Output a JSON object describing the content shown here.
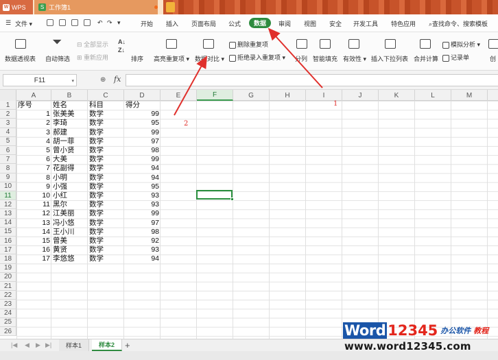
{
  "titlebar": {
    "app_label": "WPS",
    "document_tab": "工作簿1"
  },
  "menubar": {
    "file_label": "文件",
    "tabs": [
      {
        "label": "开始",
        "active": false
      },
      {
        "label": "插入",
        "active": false
      },
      {
        "label": "页面布局",
        "active": false
      },
      {
        "label": "公式",
        "active": false
      },
      {
        "label": "数据",
        "active": true
      },
      {
        "label": "审阅",
        "active": false
      },
      {
        "label": "视图",
        "active": false
      },
      {
        "label": "安全",
        "active": false
      },
      {
        "label": "开发工具",
        "active": false
      },
      {
        "label": "特色应用",
        "active": false
      }
    ],
    "search_label": "查找命令、搜索模板"
  },
  "ribbon": {
    "pivot": "数据透视表",
    "autofilter": "自动筛选",
    "show_all": "全部显示",
    "reapply": "重新应用",
    "sort": "排序",
    "highlight_duplicates": "高亮重复项",
    "data_compare": "数据对比",
    "delete_duplicates": "删除重复项",
    "reject_duplicates": "拒绝录入重复项",
    "split_columns": "分列",
    "smart_fill": "智能填充",
    "validity": "有效性",
    "insert_dropdown": "插入下拉列表",
    "consolidate": "合并计算",
    "simulation": "模拟分析",
    "record_form": "记录单",
    "create_group": "创"
  },
  "formulabar": {
    "cell_ref": "F11",
    "fx_label": "fx",
    "value": ""
  },
  "grid": {
    "columns": [
      "A",
      "B",
      "C",
      "D",
      "E",
      "F",
      "G",
      "H",
      "I",
      "J",
      "K",
      "L",
      "M"
    ],
    "selected_column": "F",
    "selected_row": 11,
    "row_count": 26,
    "headers": {
      "a": "序号",
      "b": "姓名",
      "c": "科目",
      "d": "得分"
    },
    "rows": [
      {
        "id": 1,
        "name": "张美美",
        "subject": "数学",
        "score": 99
      },
      {
        "id": 2,
        "name": "李琦",
        "subject": "数学",
        "score": 95
      },
      {
        "id": 3,
        "name": "郝建",
        "subject": "数学",
        "score": 99
      },
      {
        "id": 4,
        "name": "胡一菲",
        "subject": "数学",
        "score": 97
      },
      {
        "id": 5,
        "name": "曾小贤",
        "subject": "数学",
        "score": 98
      },
      {
        "id": 6,
        "name": "大美",
        "subject": "数学",
        "score": 99
      },
      {
        "id": 7,
        "name": "花副得",
        "subject": "数学",
        "score": 94
      },
      {
        "id": 8,
        "name": "小明",
        "subject": "数学",
        "score": 94
      },
      {
        "id": 9,
        "name": "小强",
        "subject": "数学",
        "score": 95
      },
      {
        "id": 10,
        "name": "小红",
        "subject": "数学",
        "score": 93
      },
      {
        "id": 11,
        "name": "黑尔",
        "subject": "数学",
        "score": 93
      },
      {
        "id": 12,
        "name": "江美丽",
        "subject": "数学",
        "score": 99
      },
      {
        "id": 13,
        "name": "冯小悠",
        "subject": "数学",
        "score": 97
      },
      {
        "id": 14,
        "name": "王小川",
        "subject": "数学",
        "score": 98
      },
      {
        "id": 15,
        "name": "曾美",
        "subject": "数学",
        "score": 92
      },
      {
        "id": 16,
        "name": "黄贤",
        "subject": "数学",
        "score": 93
      },
      {
        "id": 17,
        "name": "李悠悠",
        "subject": "数学",
        "score": 94
      }
    ]
  },
  "annotations": {
    "marker_1": "1",
    "marker_2": "2",
    "color": "#e0302c"
  },
  "sheets": [
    {
      "label": "样本1",
      "active": false
    },
    {
      "label": "样本2",
      "active": true
    }
  ],
  "add_sheet_label": "+",
  "watermark": {
    "word": "Word",
    "digits": "12345",
    "cn_blue": "办公软件",
    "cn_red": "教程",
    "url": "www.word12345.com"
  },
  "colors": {
    "accent": "#2e8b3f",
    "wps_orange": "#d86a42"
  }
}
